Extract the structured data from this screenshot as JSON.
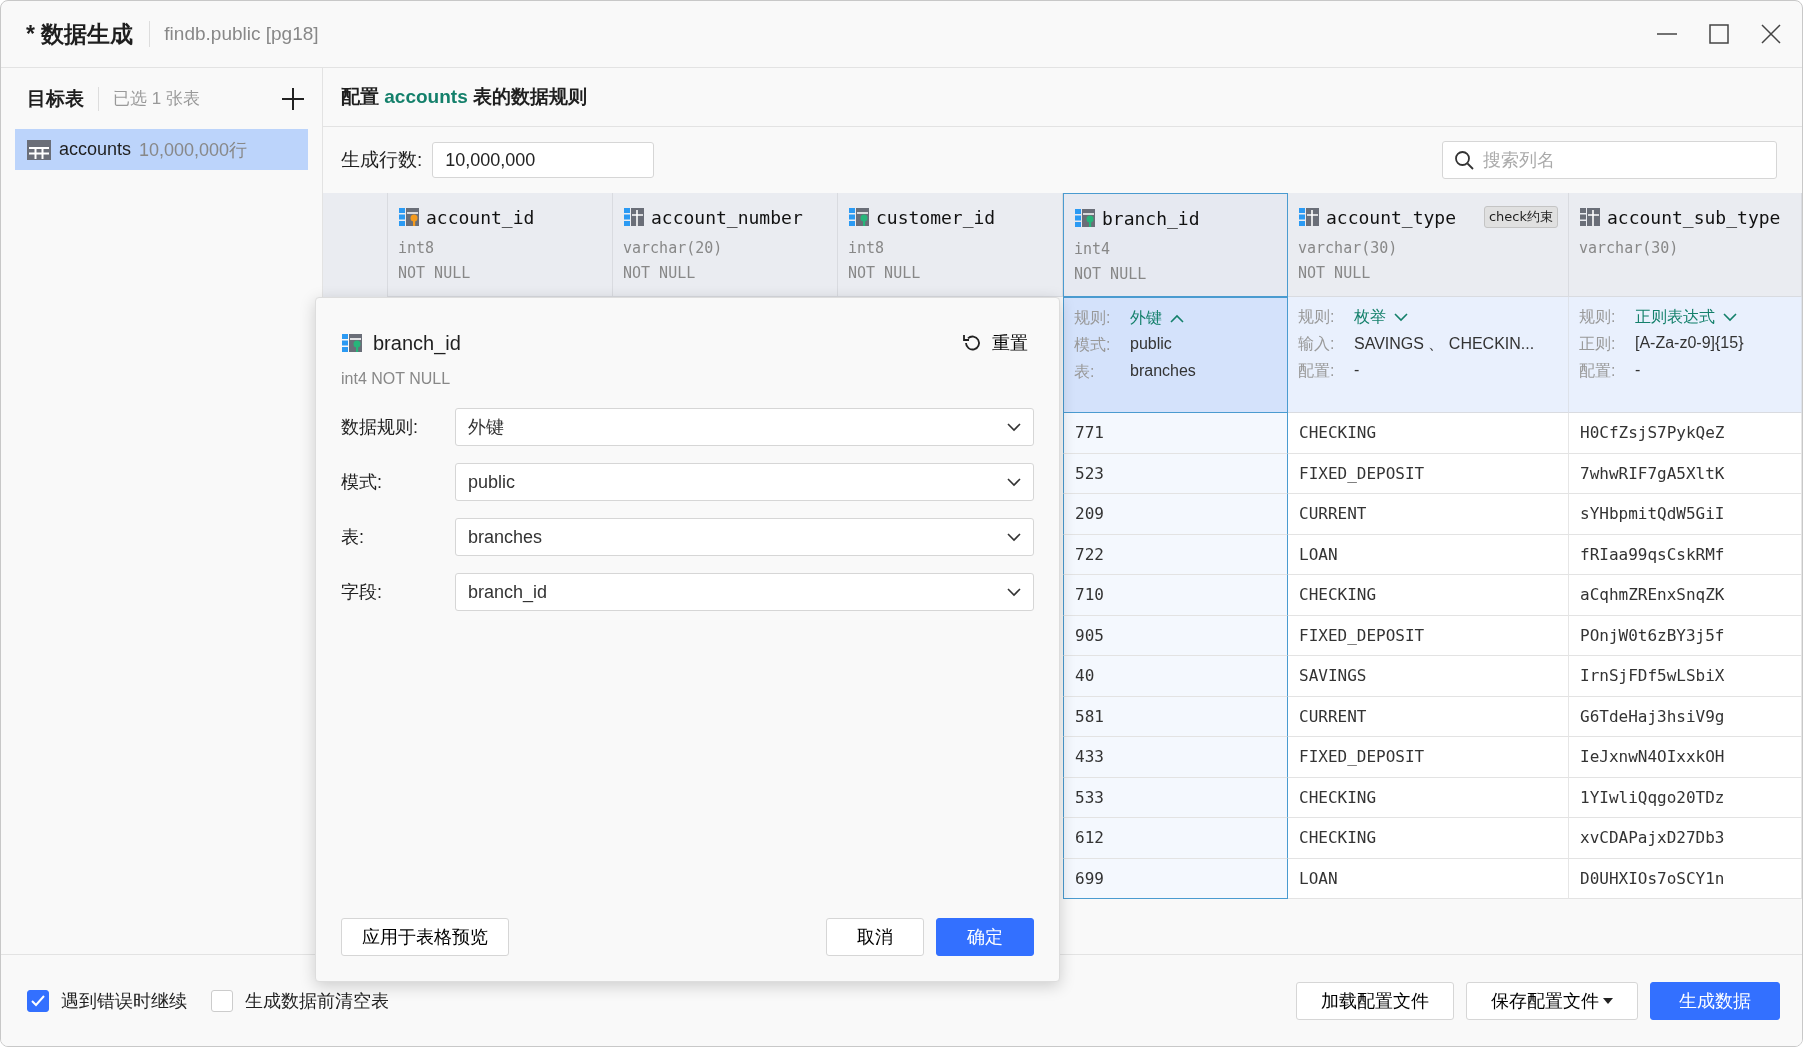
{
  "window": {
    "title": "* 数据生成",
    "subtitle": "findb.public [pg18]"
  },
  "sidebar": {
    "title": "目标表",
    "selected_count": "已选 1 张表",
    "items": [
      {
        "name": "accounts",
        "rows": "10,000,000行",
        "selected": true
      }
    ]
  },
  "main": {
    "heading_prefix": "配置",
    "table_name": "accounts",
    "heading_suffix": "表的数据规则",
    "row_count": {
      "label": "生成行数:",
      "value": "10,000,000"
    },
    "search": {
      "placeholder": "搜索列名"
    }
  },
  "columns": [
    {
      "name": "account_id",
      "type": "int8",
      "null": "NOT NULL",
      "kind": "primary-key",
      "selected": false
    },
    {
      "name": "account_number",
      "type": "varchar(20)",
      "null": "NOT NULL",
      "kind": "column",
      "selected": false
    },
    {
      "name": "customer_id",
      "type": "int8",
      "null": "NOT NULL",
      "kind": "foreign-key",
      "selected": false
    },
    {
      "name": "branch_id",
      "type": "int4",
      "null": "NOT NULL",
      "kind": "foreign-key",
      "selected": true,
      "rule": {
        "label": "规则:",
        "value": "外键",
        "expanded": true
      },
      "details": [
        {
          "label": "模式:",
          "value": "public"
        },
        {
          "label": "表:",
          "value": "branches"
        }
      ]
    },
    {
      "name": "account_type",
      "type": "varchar(30)",
      "null": "NOT NULL",
      "kind": "column",
      "selected": false,
      "badge": "check约束",
      "rule": {
        "label": "规则:",
        "value": "枚举",
        "expanded": false
      },
      "details": [
        {
          "label": "输入:",
          "value": "SAVINGS 、 CHECKIN..."
        },
        {
          "label": "配置:",
          "value": "-"
        }
      ]
    },
    {
      "name": "account_sub_type",
      "type": "varchar(30)",
      "kind": "column-muted",
      "selected": false,
      "rule": {
        "label": "规则:",
        "value": "正则表达式",
        "expanded": false
      },
      "details": [
        {
          "label": "正则:",
          "value": "[A-Za-z0-9]{15}"
        },
        {
          "label": "配置:",
          "value": "-"
        }
      ]
    }
  ],
  "rows": [
    [
      "771",
      "CHECKING",
      "H0CfZsjS7PykQeZ"
    ],
    [
      "523",
      "FIXED_DEPOSIT",
      "7whwRIF7gA5XltK"
    ],
    [
      "209",
      "CURRENT",
      "sYHbpmitQdW5GiI"
    ],
    [
      "722",
      "LOAN",
      "fRIaa99qsCskRMf"
    ],
    [
      "710",
      "CHECKING",
      "aCqhmZREnxSnqZK"
    ],
    [
      "905",
      "FIXED_DEPOSIT",
      "POnjW0t6zBY3j5f"
    ],
    [
      "40",
      "SAVINGS",
      "IrnSjFDf5wLSbiX"
    ],
    [
      "581",
      "CURRENT",
      "G6TdeHaj3hsiV9g"
    ],
    [
      "433",
      "FIXED_DEPOSIT",
      "IeJxnwN4OIxxkOH"
    ],
    [
      "533",
      "CHECKING",
      "1YIwliQqgo20TDz"
    ],
    [
      "612",
      "CHECKING",
      "xvCDAPajxD27Db3"
    ],
    [
      "699",
      "LOAN",
      "D0UHXIOs7oSCY1n"
    ]
  ],
  "popup": {
    "kind": "foreign-key",
    "title": "branch_id",
    "subtitle": "int4 NOT NULL",
    "reset": "重置",
    "fields": [
      {
        "label": "数据规则:",
        "value": "外键"
      },
      {
        "label": "模式:",
        "value": "public"
      },
      {
        "label": "表:",
        "value": "branches"
      },
      {
        "label": "字段:",
        "value": "branch_id"
      }
    ],
    "apply": "应用于表格预览",
    "cancel": "取消",
    "ok": "确定"
  },
  "footer": {
    "options": [
      {
        "label": "遇到错误时继续",
        "checked": true
      },
      {
        "label": "生成数据前清空表",
        "checked": false
      }
    ],
    "buttons": [
      {
        "label": "加载配置文件",
        "kind": "default"
      },
      {
        "label": "保存配置文件",
        "kind": "menu"
      },
      {
        "label": "生成数据",
        "kind": "primary"
      }
    ]
  }
}
